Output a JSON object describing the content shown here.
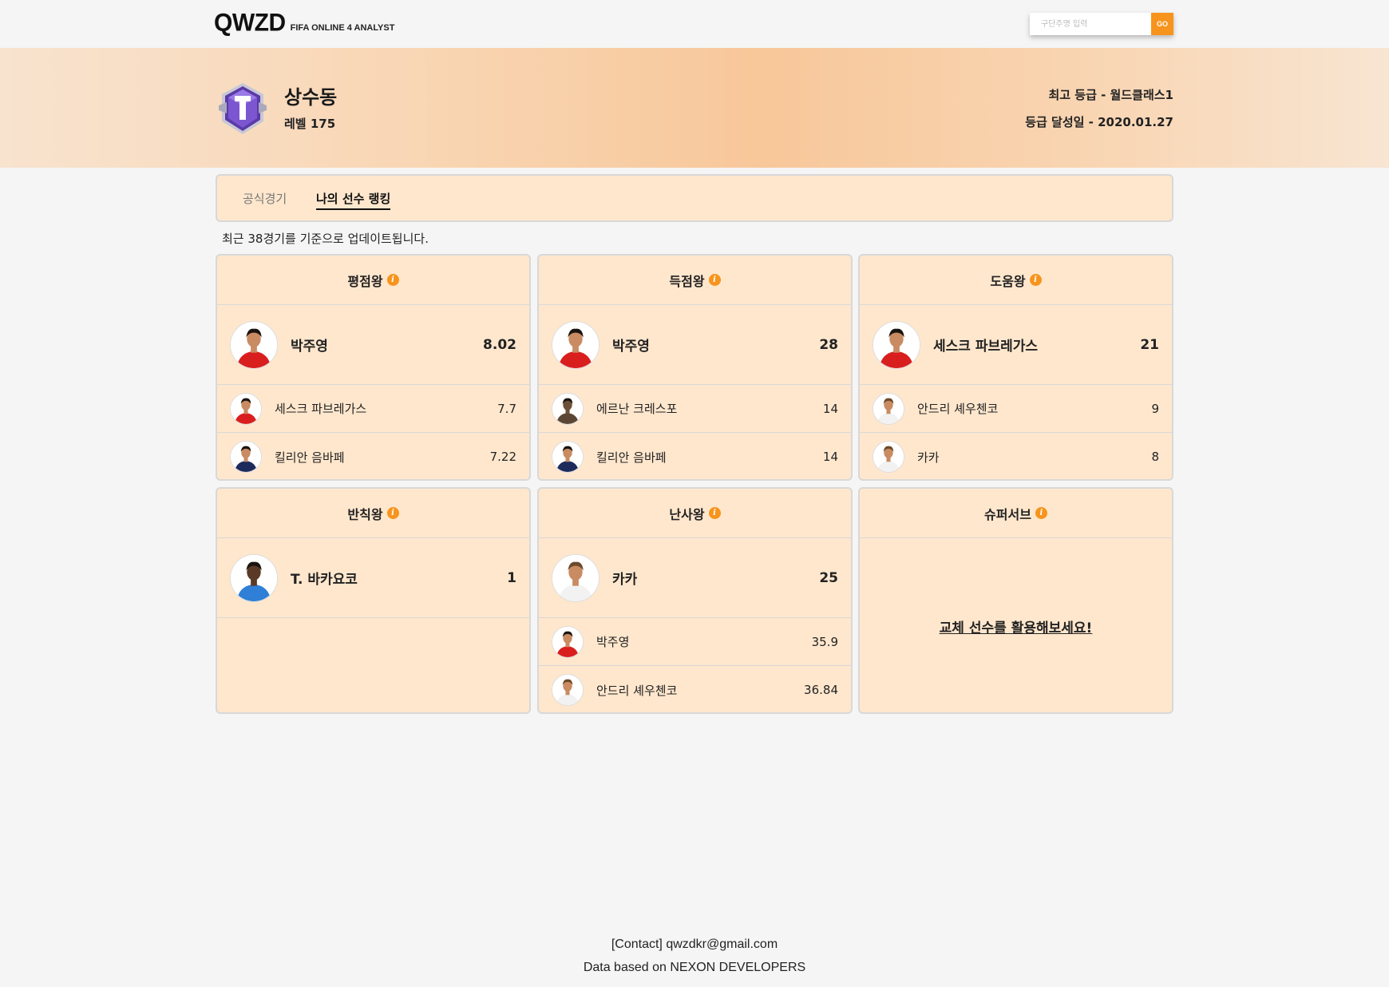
{
  "header": {
    "logo": "QWZD",
    "logo_sub": "FIFA ONLINE 4 ANALYST",
    "search_placeholder": "구단주명 입력",
    "search_button": "GO"
  },
  "profile": {
    "nickname": "상수동",
    "level": "레벨 175",
    "best_grade": "최고 등급 - 월드클래스1",
    "achieved_date": "등급 달성일 - 2020.01.27",
    "emblem_icon": "world-class-1-emblem-icon"
  },
  "tabs": [
    "공식경기",
    "나의 선수 랭킹"
  ],
  "active_tab": 1,
  "notice": "최근 38경기를 기준으로 업데이트됩니다.",
  "cards": [
    {
      "title": "평점왕",
      "top": {
        "name": "박주영",
        "value": "8.02",
        "kit": "red"
      },
      "rest": [
        {
          "name": "세스크 파브레가스",
          "value": "7.7",
          "kit": "red"
        },
        {
          "name": "킬리안 음바페",
          "value": "7.22",
          "kit": "navy"
        }
      ]
    },
    {
      "title": "득점왕",
      "top": {
        "name": "박주영",
        "value": "28",
        "kit": "red"
      },
      "rest": [
        {
          "name": "에르난 크레스포",
          "value": "14",
          "kit": "sepia"
        },
        {
          "name": "킬리안 음바페",
          "value": "14",
          "kit": "navy"
        }
      ]
    },
    {
      "title": "도움왕",
      "top": {
        "name": "세스크 파브레가스",
        "value": "21",
        "kit": "red"
      },
      "rest": [
        {
          "name": "안드리 셰우첸코",
          "value": "9",
          "kit": "white"
        },
        {
          "name": "카카",
          "value": "8",
          "kit": "white"
        }
      ]
    },
    {
      "title": "반칙왕",
      "top": {
        "name": "T. 바카요코",
        "value": "1",
        "kit": "blue"
      },
      "rest": []
    },
    {
      "title": "난사왕",
      "top": {
        "name": "카카",
        "value": "25",
        "kit": "white"
      },
      "rest": [
        {
          "name": "박주영",
          "value": "35.9",
          "kit": "red"
        },
        {
          "name": "안드리 셰우첸코",
          "value": "36.84",
          "kit": "white"
        }
      ]
    },
    {
      "title": "슈퍼서브",
      "top": null,
      "rest": [],
      "empty_text": "교체 선수를 활용해보세요!"
    }
  ],
  "footer": {
    "contact": "[Contact] qwzdkr@gmail.com",
    "data_source": "Data based on NEXON DEVELOPERS"
  },
  "colors": {
    "accent": "#f7941d",
    "card_bg": "#ffe7cd",
    "banner_mid": "#f8c79a",
    "kit_red": "#d91e1e",
    "kit_navy": "#1d2a5c",
    "kit_blue": "#2f7fd6",
    "kit_sepia": "#5a4632",
    "kit_white": "#f2f2f2"
  }
}
